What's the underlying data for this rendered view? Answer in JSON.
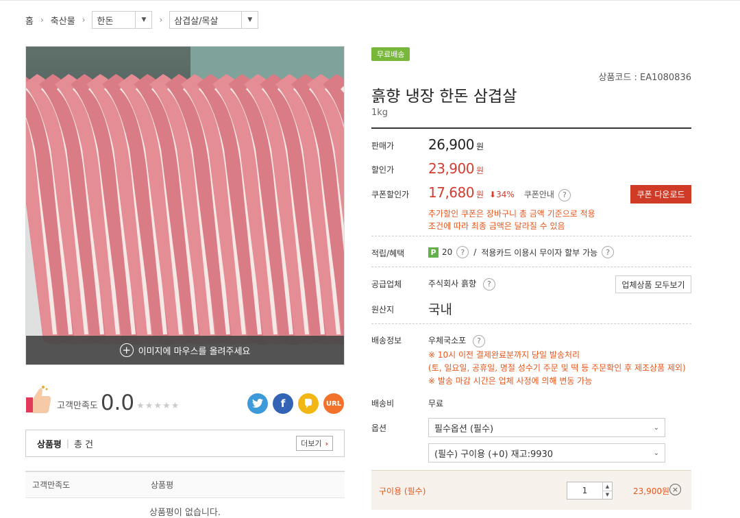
{
  "breadcrumb": {
    "home": "홈",
    "level1": "축산물",
    "level2": "한돈",
    "level3": "삼겹살/목살"
  },
  "image": {
    "hover_hint": "이미지에 마우스를 올려주세요"
  },
  "satisfaction": {
    "label": "고객만족도",
    "score": "0.0",
    "stars": "★★★★★"
  },
  "social": [
    {
      "icon": "twitter-icon",
      "glyph": "t",
      "color": "#3d9ad8"
    },
    {
      "icon": "facebook-icon",
      "glyph": "f",
      "color": "#3263b5"
    },
    {
      "icon": "kakao-icon",
      "glyph": "k",
      "color": "#f2b714"
    },
    {
      "icon": "url-icon",
      "glyph": "URL",
      "color": "#f2722c"
    }
  ],
  "reviews": {
    "title": "상품평",
    "count_label": "총 건",
    "more_label": "더보기",
    "col_satisfaction": "고객만족도",
    "col_review": "상품평",
    "empty_text": "상품평이 없습니다."
  },
  "product": {
    "badge": "무료배송",
    "code_label": "상품코드 : EA1080836",
    "title": "흙향 냉장 한돈 삼겹살",
    "subtitle": "1kg"
  },
  "pricing": {
    "sale_label": "판매가",
    "sale_value": "26,900",
    "discount_label": "할인가",
    "discount_value": "23,900",
    "coupon_label": "쿠폰할인가",
    "coupon_value": "17,680",
    "unit": "원",
    "coupon_percent": "⬇34%",
    "coupon_info": "쿠폰안내",
    "download_button": "쿠폰 다운로드",
    "notes": [
      "추가할인 쿠폰은 장바구니 총 금액 기준으로 적용",
      "조건에 따라 최종 금액은 달라질 수 있음"
    ]
  },
  "benefit": {
    "label": "적립/혜택",
    "points": "20",
    "separator": "/",
    "card_text": "적용카드 이용시 무이자 할부 가능"
  },
  "supplier": {
    "label": "공급업체",
    "name": "주식회사 흙향",
    "view_all": "업체상품 모두보기"
  },
  "origin": {
    "label": "원산지",
    "value": "국내"
  },
  "shipping": {
    "label": "배송정보",
    "method": "우체국소포",
    "notes": [
      "※ 10시 이전 결제완료분까지 당일 발송처리",
      "(토, 일요일, 공휴일, 명절 성수기 주문 및 떡 등 주문확인 후 제조상품 제외)",
      "※ 발송 마감 시간은 업체 사정에 의해 변동 가능"
    ],
    "fee_label": "배송비",
    "fee_value": "무료"
  },
  "options": {
    "label": "옵션",
    "select1": "필수옵션 (필수)",
    "select2": "(필수) 구이용 (+0) 재고:9930"
  },
  "cart_item": {
    "name": "구이용 (필수)",
    "quantity": "1",
    "price": "23,900원"
  }
}
